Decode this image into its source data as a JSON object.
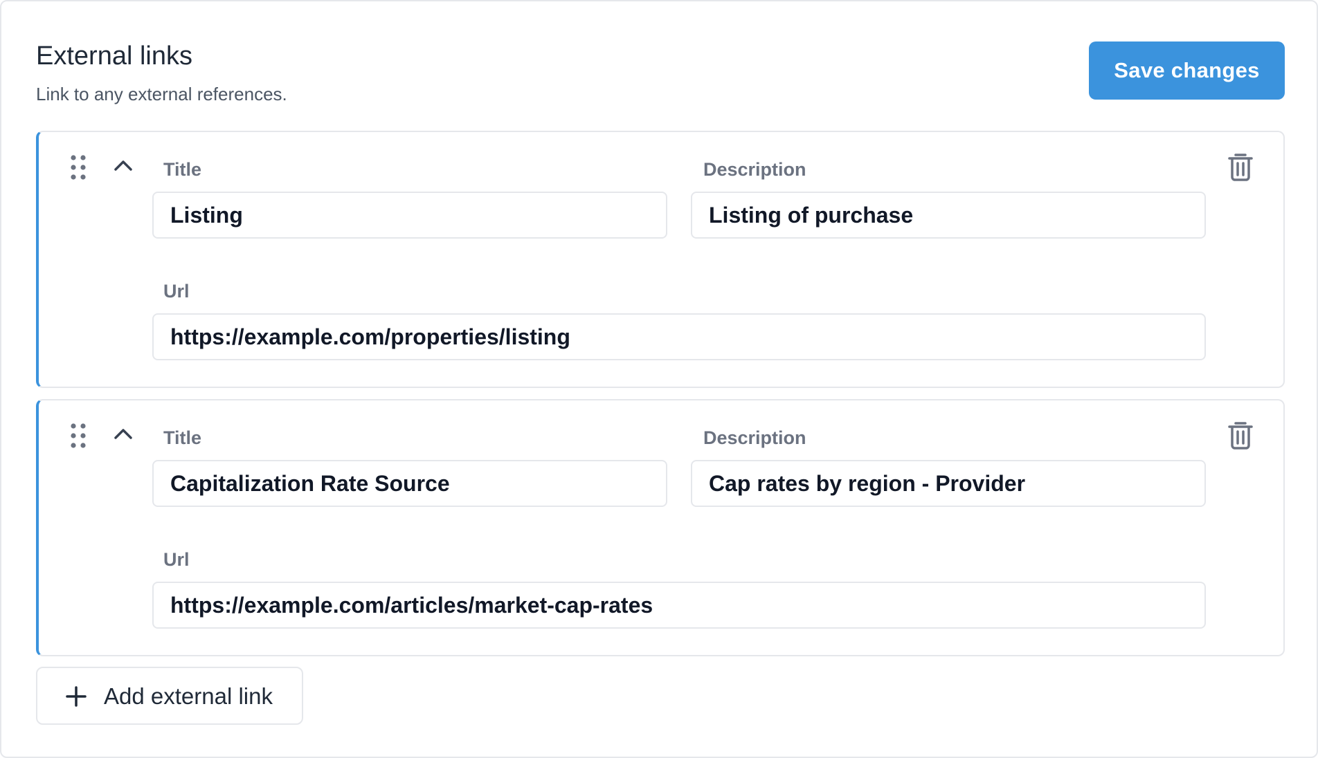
{
  "section": {
    "title": "External links",
    "subtitle": "Link to any external references."
  },
  "save_button": {
    "label": "Save changes"
  },
  "field_labels": {
    "title": "Title",
    "description": "Description",
    "url": "Url"
  },
  "links": [
    {
      "title": "Listing",
      "description": "Listing of purchase",
      "url": "https://example.com/properties/listing"
    },
    {
      "title": "Capitalization Rate Source",
      "description": "Cap rates by region - Provider",
      "url": "https://example.com/articles/market-cap-rates"
    }
  ],
  "add_button": {
    "label": "Add external link"
  },
  "icons": {
    "drag": "drag-handle-icon",
    "collapse": "chevron-up-icon",
    "delete": "trash-icon",
    "add": "plus-icon"
  },
  "colors": {
    "accent": "#3b93dd",
    "border": "#e5e7eb",
    "label": "#6b7280",
    "text": "#111827"
  }
}
